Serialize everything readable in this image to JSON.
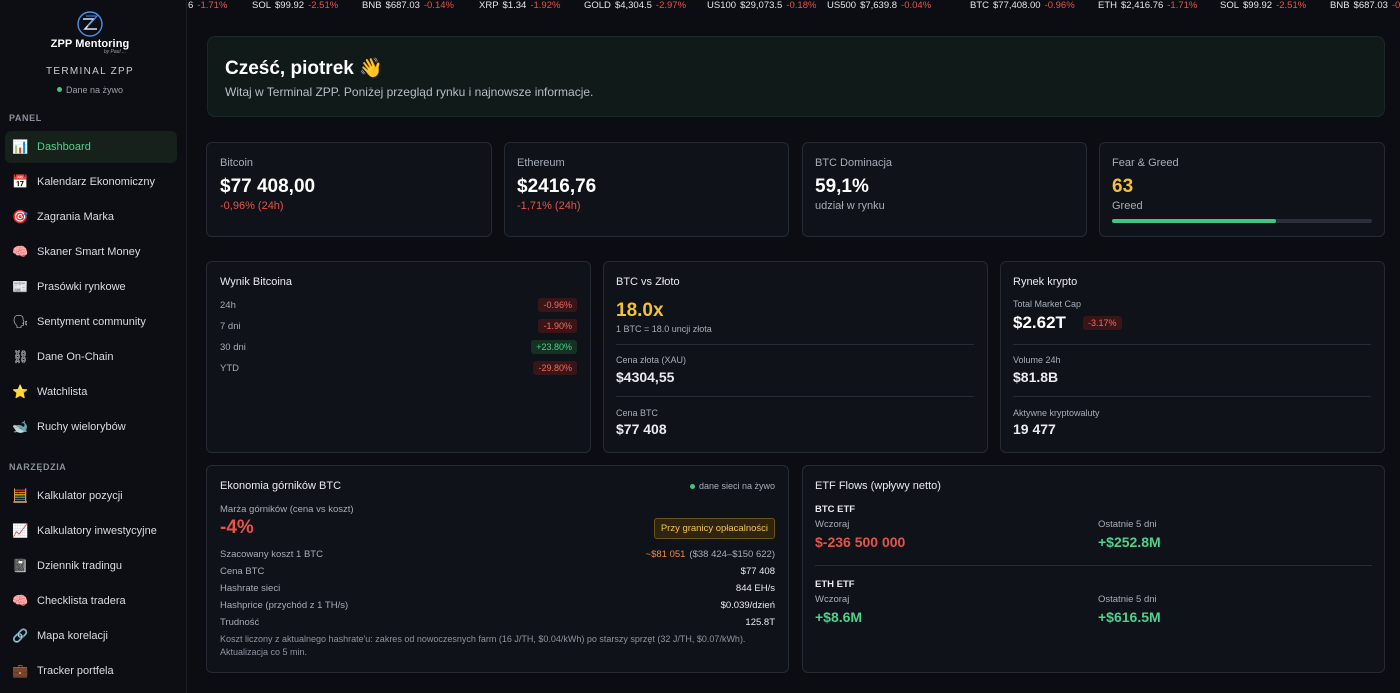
{
  "brand": {
    "name": "ZPP Mentoring",
    "signature": "by Paul ..."
  },
  "sidebar": {
    "terminal_label": "TERMINAL ZPP",
    "live_label": "Dane na żywo",
    "panel_label": "PANEL",
    "tools_label": "NARZĘDZIA",
    "panel_items": [
      {
        "label": "Dashboard",
        "icon": "📊",
        "active": true
      },
      {
        "label": "Kalendarz Ekonomiczny",
        "icon": "📅"
      },
      {
        "label": "Zagrania Marka",
        "icon": "🎯"
      },
      {
        "label": "Skaner Smart Money",
        "icon": "🧠"
      },
      {
        "label": "Prasówki rynkowe",
        "icon": "📰"
      },
      {
        "label": "Sentyment community",
        "icon": "🗣"
      },
      {
        "label": "Dane On-Chain",
        "icon": "⛓"
      },
      {
        "label": "Watchlista",
        "icon": "⭐"
      },
      {
        "label": "Ruchy wielorybów",
        "icon": "🐋"
      }
    ],
    "tool_items": [
      {
        "label": "Kalkulator pozycji",
        "icon": "🧮"
      },
      {
        "label": "Kalkulatory inwestycyjne",
        "icon": "📈"
      },
      {
        "label": "Dziennik tradingu",
        "icon": "📓"
      },
      {
        "label": "Checklista tradera",
        "icon": "🧠"
      },
      {
        "label": "Mapa korelacji",
        "icon": "🔗"
      },
      {
        "label": "Tracker portfela",
        "icon": "💼"
      }
    ]
  },
  "ticker": [
    {
      "sym": "6",
      "price": "",
      "change": "-1.71%"
    },
    {
      "sym": "SOL",
      "price": "$99.92",
      "change": "-2.51%"
    },
    {
      "sym": "BNB",
      "price": "$687.03",
      "change": "-0.14%"
    },
    {
      "sym": "XRP",
      "price": "$1.34",
      "change": "-1.92%"
    },
    {
      "sym": "GOLD",
      "price": "$4,304.5",
      "change": "-2.97%"
    },
    {
      "sym": "US100",
      "price": "$29,073.5",
      "change": "-0.18%"
    },
    {
      "sym": "US500",
      "price": "$7,639.8",
      "change": "-0.04%"
    },
    {
      "sym": "BTC",
      "price": "$77,408.00",
      "change": "-0.96%"
    },
    {
      "sym": "ETH",
      "price": "$2,416.76",
      "change": "-1.71%"
    },
    {
      "sym": "SOL",
      "price": "$99.92",
      "change": "-2.51%"
    },
    {
      "sym": "BNB",
      "price": "$687.03",
      "change": "-0.14%"
    }
  ],
  "hero": {
    "title": "Cześć, piotrek 👋",
    "subtitle": "Witaj w Terminal ZPP. Poniżej przegląd rynku i najnowsze informacje."
  },
  "stats": {
    "bitcoin": {
      "label": "Bitcoin",
      "value": "$77 408,00",
      "change": "-0,96% (24h)"
    },
    "ethereum": {
      "label": "Ethereum",
      "value": "$2416,76",
      "change": "-1,71% (24h)"
    },
    "dominance": {
      "label": "BTC Dominacja",
      "value": "59,1%",
      "sub": "udział w rynku"
    },
    "fear_greed": {
      "label": "Fear & Greed",
      "value": "63",
      "sub": "Greed",
      "level": 0.63
    }
  },
  "btc_performance": {
    "title": "Wynik Bitcoina",
    "rows": [
      {
        "label": "24h",
        "value": "-0.96%",
        "tone": "red"
      },
      {
        "label": "7 dni",
        "value": "-1.90%",
        "tone": "red"
      },
      {
        "label": "30 dni",
        "value": "+23.80%",
        "tone": "green"
      },
      {
        "label": "YTD",
        "value": "-29.80%",
        "tone": "red"
      }
    ]
  },
  "btc_gold": {
    "title": "BTC vs Złoto",
    "ratio": "18.0x",
    "ratio_sub": "1 BTC = 18.0 uncji złota",
    "gold_label": "Cena złota (XAU)",
    "gold_value": "$4304,55",
    "btc_label": "Cena BTC",
    "btc_value": "$77 408"
  },
  "crypto_market": {
    "title": "Rynek krypto",
    "mcap_label": "Total Market Cap",
    "mcap_value": "$2.62T",
    "mcap_change": "-3.17%",
    "volume_label": "Volume 24h",
    "volume_value": "$81.8B",
    "active_label": "Aktywne kryptowaluty",
    "active_value": "19 477"
  },
  "miners": {
    "title": "Ekonomia górników BTC",
    "live_note": "dane sieci na żywo",
    "margin_label": "Marża górników (cena vs koszt)",
    "margin_value": "-4%",
    "badge": "Przy granicy opłacalności",
    "rows": [
      {
        "label": "Szacowany koszt 1 BTC",
        "value": "~$81 051",
        "extra": "($38 424–$150 622)"
      },
      {
        "label": "Cena BTC",
        "value": "$77 408",
        "extra": ""
      },
      {
        "label": "Hashrate sieci",
        "value": "844 EH/s",
        "extra": ""
      },
      {
        "label": "Hashprice (przychód z 1 TH/s)",
        "value": "$0.039/dzień",
        "extra": ""
      },
      {
        "label": "Trudność",
        "value": "125.8T",
        "extra": ""
      }
    ],
    "footnote": "Koszt liczony z aktualnego hashrate'u: zakres od nowoczesnych farm (16 J/TH, $0.04/kWh) po starszy sprzęt (32 J/TH, $0.07/kWh). Aktualizacja co 5 min."
  },
  "etf": {
    "title": "ETF Flows (wpływy netto)",
    "btc": {
      "label": "BTC ETF",
      "yesterday_label": "Wczoraj",
      "yesterday_value": "$-236 500 000",
      "five_label": "Ostatnie 5 dni",
      "five_value": "+$252.8M"
    },
    "eth": {
      "label": "ETH ETF",
      "yesterday_label": "Wczoraj",
      "yesterday_value": "+$8.6M",
      "five_label": "Ostatnie 5 dni",
      "five_value": "+$616.5M"
    }
  },
  "colors": {
    "accent": "#4fd08c",
    "negative": "#e5534b",
    "warning": "#f2c233"
  }
}
